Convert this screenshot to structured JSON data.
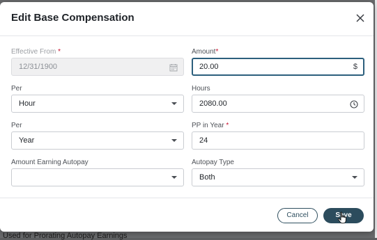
{
  "dialog": {
    "title": "Edit Base Compensation",
    "close_label": "×"
  },
  "fields": {
    "effective_from": {
      "label": "Effective From",
      "required": true,
      "value": "12/31/1900",
      "disabled": true,
      "icon": "calendar-icon"
    },
    "amount": {
      "label": "Amount",
      "required": true,
      "value": "20.00",
      "suffix": "$",
      "focused": true
    },
    "per_1": {
      "label": "Per",
      "value": "Hour"
    },
    "hours": {
      "label": "Hours",
      "value": "2080.00",
      "icon": "clock-icon"
    },
    "per_2": {
      "label": "Per",
      "value": "Year"
    },
    "pp_in_year": {
      "label": "PP in Year",
      "required": true,
      "value": "24"
    },
    "amount_earning_autopay": {
      "label": "Amount Earning Autopay",
      "value": ""
    },
    "autopay_type": {
      "label": "Autopay Type",
      "value": "Both"
    }
  },
  "required_marker": "*",
  "buttons": {
    "cancel": "Cancel",
    "save": "Save"
  },
  "background": {
    "partial_text": "Used for Prorating Autopay Earnings"
  },
  "colors": {
    "primary": "#2c4c5d",
    "focus_border": "#2c5f7d",
    "required": "#c8102e"
  }
}
